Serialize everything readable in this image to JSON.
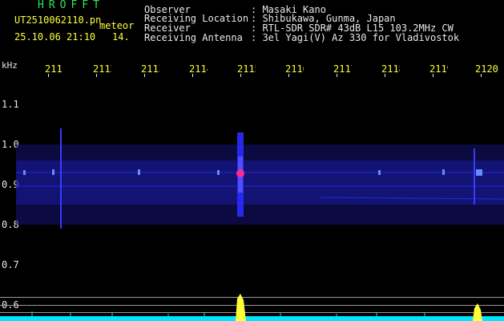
{
  "header": {
    "brand": "HROFFT",
    "filename": "UT2510062110.pn",
    "meteor_label": "meteor",
    "datetime": "25.10.06 21:10",
    "count": "14.",
    "info": [
      {
        "label": "Observer",
        "value": ": Masaki Kano"
      },
      {
        "label": "Receiving Location",
        "value": ": Shibukawa, Gunma, Japan"
      },
      {
        "label": "Receiver",
        "value": ": RTL-SDR SDR# 43dB L15 103.2MHz CW"
      },
      {
        "label": "Receiving Antenna",
        "value": ": 3el Yagi(V) Az 330 for Vladivostok"
      }
    ]
  },
  "axis": {
    "unit": "kHz",
    "y_ticks": [
      "1.1",
      "1.0",
      "0.9",
      "0.8",
      "0.7",
      "0.6"
    ],
    "x_ticks": [
      "2111",
      "2112",
      "2113",
      "2114",
      "2115",
      "2116",
      "2117",
      "2118",
      "2119",
      "2120"
    ]
  },
  "colors": {
    "background": "#000000",
    "text": "#e8e8e8",
    "labels": "#ffff3a",
    "brand": "#2ee85a",
    "signal": "#1b1bd0",
    "meteor_head": "#ff2a8a",
    "amplitude": "#00e5ff"
  }
}
